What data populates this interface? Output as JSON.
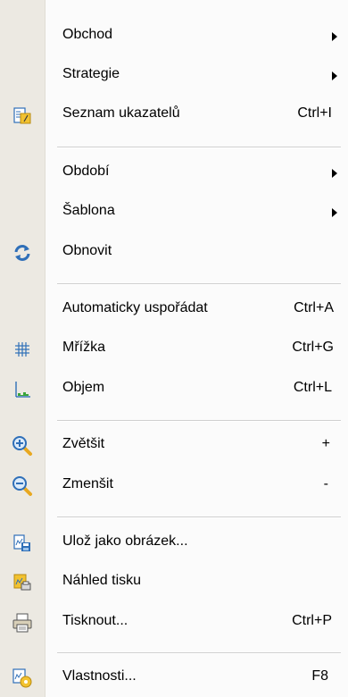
{
  "menu": {
    "items": [
      {
        "label": "Obchod",
        "icon": "none",
        "submenu": true
      },
      {
        "label": "Strategie",
        "icon": "none",
        "submenu": true
      },
      {
        "label": "Seznam ukazatelů",
        "icon": "indicator-list-icon",
        "shortcut": "Ctrl+I"
      },
      {
        "label": "Období",
        "icon": "none",
        "submenu": true
      },
      {
        "label": "Šablona",
        "icon": "none",
        "submenu": true
      },
      {
        "label": "Obnovit",
        "icon": "refresh-icon"
      },
      {
        "label": "Automaticky uspořádat",
        "icon": "none",
        "shortcut": "Ctrl+A"
      },
      {
        "label": "Mřížka",
        "icon": "grid-icon",
        "shortcut": "Ctrl+G"
      },
      {
        "label": "Objem",
        "icon": "volume-chart-icon",
        "shortcut": "Ctrl+L"
      },
      {
        "label": "Zvětšit",
        "icon": "zoom-in-icon",
        "shortcut": "+"
      },
      {
        "label": "Zmenšit",
        "icon": "zoom-out-icon",
        "shortcut": "-"
      },
      {
        "label": "Ulož jako obrázek...",
        "icon": "save-image-icon"
      },
      {
        "label": "Náhled tisku",
        "icon": "print-preview-icon"
      },
      {
        "label": "Tisknout...",
        "icon": "printer-icon",
        "shortcut": "Ctrl+P"
      },
      {
        "label": "Vlastnosti...",
        "icon": "properties-icon",
        "shortcut": "F8"
      }
    ]
  },
  "colors": {
    "gutter": "#ece9e2",
    "menu_background": "#fbfbfb",
    "separator": "#d0d0d0",
    "icon_blue": "#2f6fb8",
    "icon_yellow": "#f2c230"
  }
}
